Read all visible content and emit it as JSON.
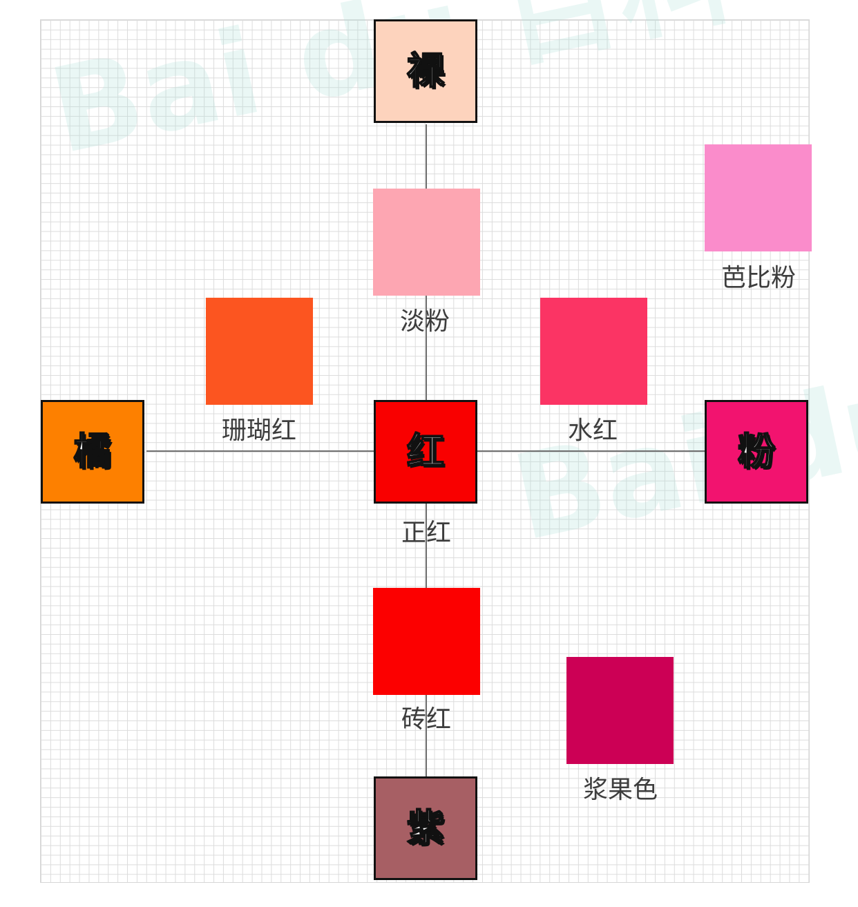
{
  "watermark": {
    "text": "Bai du 百科"
  },
  "hubs": [
    {
      "id": "nude",
      "label": "裸",
      "color": "#fdd3bd"
    },
    {
      "id": "orange",
      "label": "橘",
      "color": "#fd8000"
    },
    {
      "id": "red",
      "label": "红",
      "color": "#f90000"
    },
    {
      "id": "pink",
      "label": "粉",
      "color": "#f2136f"
    },
    {
      "id": "purple",
      "label": "紫",
      "color": "#a75f64"
    }
  ],
  "swatches": [
    {
      "id": "light-pink",
      "label": "淡粉",
      "color": "#fda6b2"
    },
    {
      "id": "barbie-pink",
      "label": "芭比粉",
      "color": "#fa8ccb"
    },
    {
      "id": "coral-red",
      "label": "珊瑚红",
      "color": "#fc5520"
    },
    {
      "id": "water-red",
      "label": "水红",
      "color": "#fb3464"
    },
    {
      "id": "true-red",
      "label": "正红",
      "color": ""
    },
    {
      "id": "brick-red",
      "label": "砖红",
      "color": "#fc0000"
    },
    {
      "id": "berry",
      "label": "浆果色",
      "color": "#cc0055"
    }
  ]
}
